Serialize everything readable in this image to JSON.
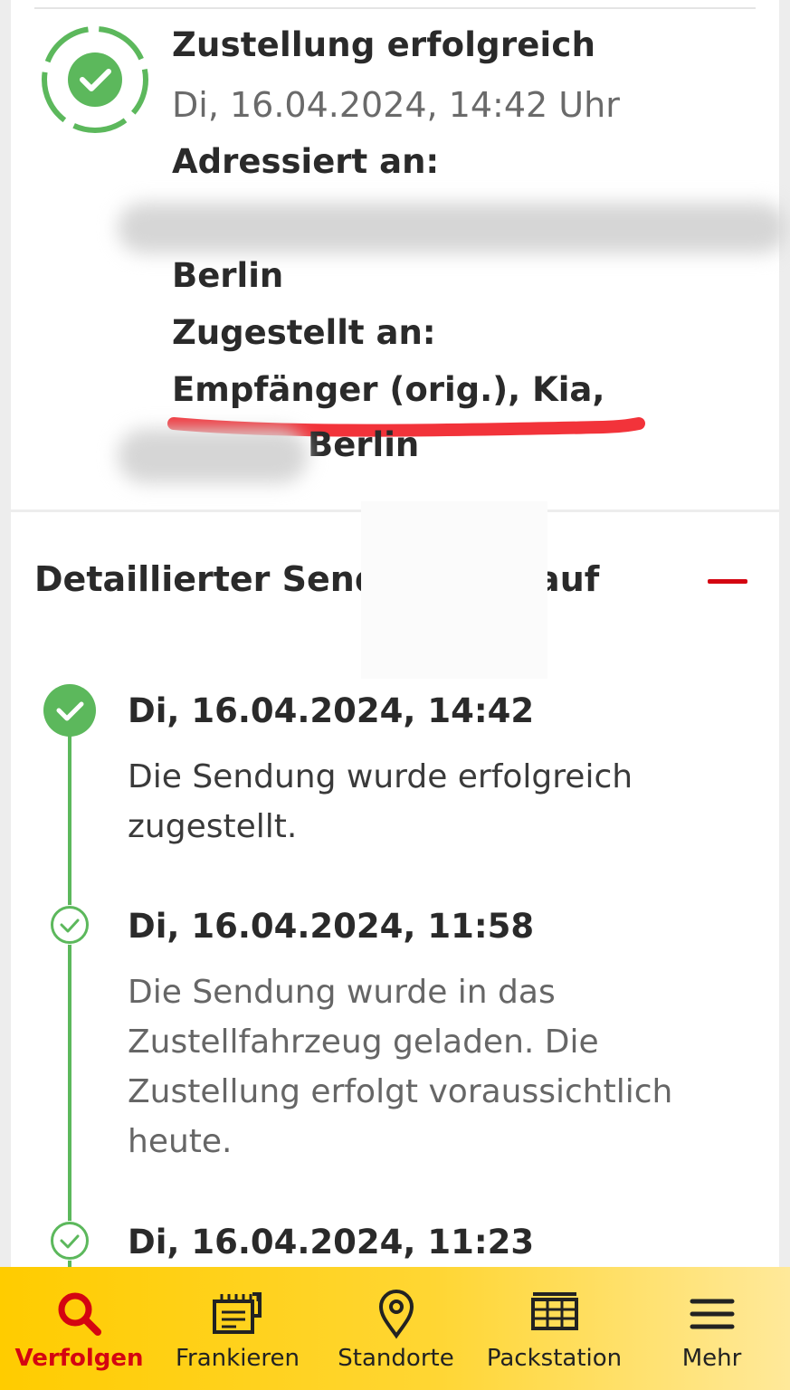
{
  "status": {
    "title": "Zustellung erfolgreich",
    "date": "Di, 16.04.2024, 14:42 Uhr",
    "addressed_label": "Adressiert an:",
    "addressed_city": "Berlin",
    "delivered_label": "Zugestellt an:",
    "delivered_value": "Empfänger (orig.), Kia,",
    "delivered_city": "Berlin",
    "colors": {
      "success": "#5cb85c",
      "underline": "#f2333a"
    }
  },
  "detail": {
    "title": "Detaillierter Send",
    "title_suffix": "auf",
    "events": [
      {
        "date": "Di, 16.04.2024, 14:42",
        "text": "Die Sendung wurde erfolgreich zugestellt."
      },
      {
        "date": "Di, 16.04.2024, 11:58",
        "text": "Die Sendung wurde in das Zustellfahrzeug geladen. Die Zustellung erfolgt voraussichtlich heute."
      },
      {
        "date": "Di, 16.04.2024, 11:23",
        "text": ""
      }
    ]
  },
  "nav": {
    "items": [
      {
        "label": "Verfolgen",
        "icon": "search-icon",
        "active": true
      },
      {
        "label": "Frankieren",
        "icon": "stamp-icon"
      },
      {
        "label": "Standorte",
        "icon": "location-pin-icon"
      },
      {
        "label": "Packstation",
        "icon": "packstation-icon"
      },
      {
        "label": "Mehr",
        "icon": "menu-icon"
      }
    ],
    "colors": {
      "background": "#ffcc00",
      "active": "#d40511"
    }
  }
}
